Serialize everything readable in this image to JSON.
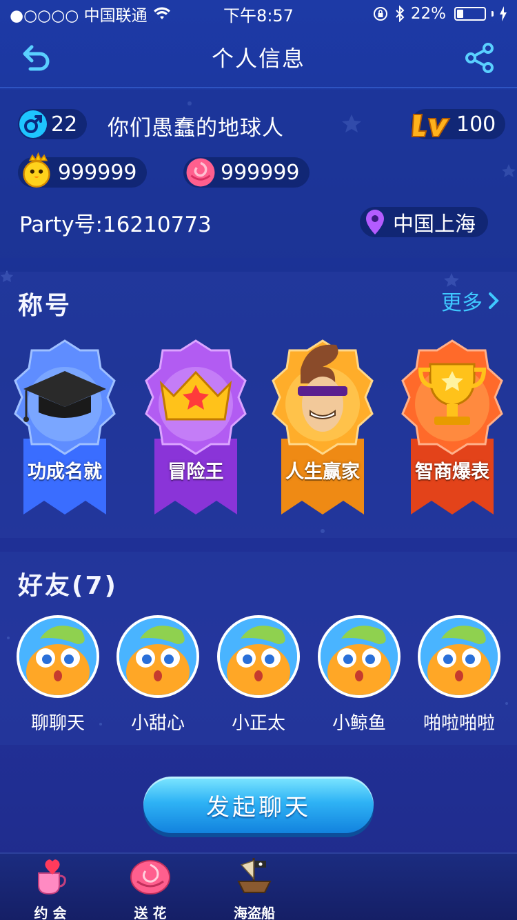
{
  "status_bar": {
    "carrier": "●○○○○ 中国联通",
    "time": "下午8:57",
    "battery": "22%"
  },
  "nav": {
    "title": "个人信息",
    "back_icon": "back-arrow-icon",
    "share_icon": "share-icon"
  },
  "profile": {
    "age": "22",
    "gender_icon": "male-icon",
    "username": "你们愚蠢的地球人",
    "level": "100",
    "coins": "999999",
    "flowers": "999999",
    "party_id": "Party号:16210773",
    "location": "中国上海"
  },
  "titles": {
    "heading": "称号",
    "more": "更多",
    "badges": [
      {
        "label": "功成名就",
        "icon": "graduation-cap-icon",
        "color": "#4f7bff"
      },
      {
        "label": "冒险王",
        "icon": "crown-icon",
        "color": "#a64ae8"
      },
      {
        "label": "人生赢家",
        "icon": "cool-guy-icon",
        "color": "#f59a1a"
      },
      {
        "label": "智商爆表",
        "icon": "trophy-icon",
        "color": "#f2561f"
      }
    ]
  },
  "friends": {
    "heading": "好友(7)",
    "list": [
      {
        "name": "聊聊天"
      },
      {
        "name": "小甜心"
      },
      {
        "name": "小正太"
      },
      {
        "name": "小鲸鱼"
      },
      {
        "name": "啪啦啪啦"
      }
    ]
  },
  "chat_button": "发起聊天",
  "tabbar": [
    {
      "label": "约 会",
      "icon": "coffee-heart-icon"
    },
    {
      "label": "送 花",
      "icon": "rose-icon"
    },
    {
      "label": "海盗船",
      "icon": "pirate-ship-icon"
    }
  ],
  "colors": {
    "accent": "#3fc8ff",
    "background": "#1d3aa6"
  }
}
